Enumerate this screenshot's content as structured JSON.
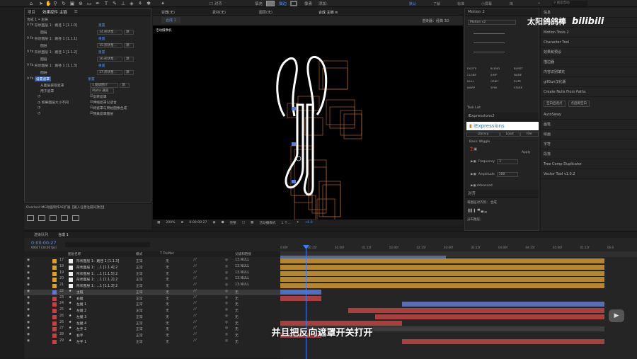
{
  "toolbar": {
    "align": "对齐",
    "fill": "填充",
    "stroke": "描边",
    "px": "像素",
    "add": "添加:",
    "workspaces": [
      "默认",
      "了解",
      "标准",
      "小屏幕",
      "库"
    ],
    "search": "搜索帮助"
  },
  "brand": {
    "name": "太阳鸽鸽棒",
    "logo": "bilibili"
  },
  "left_panel": {
    "tabs": [
      "项目",
      "效果控件 主链",
      "☰"
    ],
    "crumb": "合成 1 • 主链",
    "effects": [
      {
        "name": "形状图层 1：路径 1 [1.1.0]",
        "reset": "重置",
        "sub": "图层",
        "val": "14.形状星..."
      },
      {
        "name": "形状图层 1：路径 1 [1.1.1]",
        "reset": "重置",
        "sub": "图层",
        "val": "15.形状星..."
      },
      {
        "name": "形状图层 1：路径 1 [1.1.2]",
        "reset": "重置",
        "sub": "图层",
        "val": "16.形状星..."
      },
      {
        "name": "形状图层 1：路径 1 [1.1.3]",
        "reset": "重置",
        "sub": "图层",
        "val": "17.形状星..."
      }
    ],
    "matte_effect": {
      "name": "设置遮罩",
      "reset": "重置",
      "from_layer": "从图层获取遮罩",
      "from_val": "1.脑袋圈(T",
      "use": "用于遮罩",
      "use_val": "Alpha 通道",
      "invert": "反转遮罩",
      "stretch": "如果图层大小不同",
      "stretch_val": "伸缩遮罩以适合",
      "composite": "将遮罩与原始图像合成",
      "premult": "预乘遮罩图层"
    },
    "plugin_label": "Overlord MG动画制作AE扩展【输入任意注册码激活】"
  },
  "viewer": {
    "tabs": [
      "容器(无)",
      "素材(无)",
      "图层(无)",
      "合成 主链 ≡"
    ],
    "sub_tab": "合成 1",
    "renderer": "渲染器：经典 3D",
    "camera": "活动摄像机",
    "zoom": "200%",
    "time": "0:00:00:27",
    "quality": "完整",
    "view_camera": "活动摄像机",
    "view_count": "1 个...",
    "plus": "+0.0"
  },
  "motion": {
    "title": "Motion 2",
    "version": "Motion v2",
    "buttons": [
      "EXCITE",
      "BLEND",
      "BURST",
      "CLONE",
      "JUMP",
      "NAME",
      "NULL",
      "ORBIT",
      "ROPE",
      "WARP",
      "SPIN",
      "STARE"
    ],
    "task": "Task List"
  },
  "iexpressions": {
    "tab": "iExpressions2",
    "title": "iExpressions",
    "library": "Library",
    "load": "Load",
    "file": "File",
    "wiggle": "Basic Wiggle",
    "apply": "Apply",
    "freq_label": "Frequency",
    "freq_val": "3",
    "amp_label": "Amplitude",
    "amp_val": "100",
    "advanced": "Advanced"
  },
  "align_panel": {
    "title": "对齐",
    "align_to": "将图层对齐到：",
    "align_val": "合成",
    "distribute": "分布图层："
  },
  "right_panel": {
    "items": [
      "信息",
      "预览",
      "Motion Tools 2",
      "Character Tool",
      "效果和预设",
      "描边器",
      "内容识别填充",
      "gifGun汉化版",
      "Create Nulls From Paths"
    ],
    "null_btns": [
      "空白后遮点",
      "点后跟空白"
    ],
    "items2": [
      "AutoSway",
      "画笔",
      "绘画",
      "字符",
      "段落",
      "Tree Comp Duplicator",
      "Vector Tool v1.0.2"
    ]
  },
  "timeline": {
    "render_queue": "渲染队列",
    "comp_tab": "合成 1",
    "timecode": "0:00:00:27",
    "fps": "00027 (30.00 fps)",
    "headers": {
      "name": "图层名称",
      "mode": "模式",
      "trk": "T TrkMat",
      "parent": "父级和链接"
    },
    "ruler": [
      "0:00f",
      "00:15f",
      "01:00f",
      "01:15f",
      "02:00f",
      "02:15f",
      "03:00f",
      "03:15f",
      "04:00f",
      "04:15f",
      "05:00f",
      "05:15f",
      "06:0"
    ],
    "layers": [
      {
        "num": "17",
        "name": "形状图层 1：路径 1 [1.1.3]",
        "mode": "正常",
        "trk": "无",
        "parent": "13.NULL",
        "color": "#e0a020",
        "type": "shape"
      },
      {
        "num": "18",
        "name": "形状图层 1：...1 [1.1.4] 2",
        "mode": "正常",
        "trk": "无",
        "parent": "13.NULL",
        "color": "#e0a020",
        "type": "shape"
      },
      {
        "num": "19",
        "name": "形状图层 1：...1 [1.1.5] 2",
        "mode": "正常",
        "trk": "无",
        "parent": "13.NULL",
        "color": "#e0a020",
        "type": "shape"
      },
      {
        "num": "20",
        "name": "形状图层 1：...1 [1.1.2] 2",
        "mode": "正常",
        "trk": "无",
        "parent": "13.NULL",
        "color": "#e0a020",
        "type": "shape"
      },
      {
        "num": "21",
        "name": "形状图层 1：...1 [1.1.3] 2",
        "mode": "正常",
        "trk": "无",
        "parent": "13.NULL",
        "color": "#e0a020",
        "type": "shape"
      },
      {
        "num": "22",
        "name": "主链",
        "mode": "正常",
        "trk": "无",
        "parent": "无",
        "color": "#5a7ae0",
        "type": "star"
      },
      {
        "num": "23",
        "name": "右腿",
        "mode": "正常",
        "trk": "无",
        "parent": "无",
        "color": "#c84040",
        "type": "star"
      },
      {
        "num": "24",
        "name": "左腿 1",
        "mode": "正常",
        "trk": "无",
        "parent": "无",
        "color": "#c84040",
        "type": "star"
      },
      {
        "num": "25",
        "name": "左腿 2",
        "mode": "正常",
        "trk": "无",
        "parent": "无",
        "color": "#c84040",
        "type": "star"
      },
      {
        "num": "26",
        "name": "左腿 3",
        "mode": "正常",
        "trk": "无",
        "parent": "无",
        "color": "#c84040",
        "type": "star"
      },
      {
        "num": "26",
        "name": "左腿 4",
        "mode": "正常",
        "trk": "无",
        "parent": "无",
        "color": "#c84040",
        "type": "star"
      },
      {
        "num": "27",
        "name": "左手 2",
        "mode": "正常",
        "trk": "无",
        "parent": "无",
        "color": "#c84040",
        "type": "star"
      },
      {
        "num": "28",
        "name": "右手",
        "mode": "正常",
        "trk": "无",
        "parent": "无",
        "color": "#c84040",
        "type": "star"
      },
      {
        "num": "29",
        "name": "左手 1",
        "mode": "正常",
        "trk": "无",
        "parent": "无",
        "color": "#c84040",
        "type": "star"
      }
    ]
  },
  "subtitle": "并且把反向遮罩开关打开"
}
